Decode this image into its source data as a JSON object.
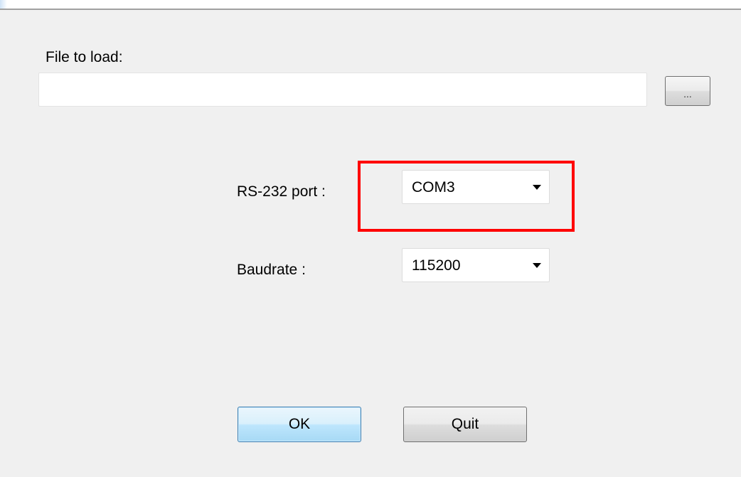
{
  "form": {
    "file_label": "File to load:",
    "file_value": "",
    "browse_label": "...",
    "port_label": "RS-232 port :",
    "port_value": "COM3",
    "baud_label": "Baudrate :",
    "baud_value": "115200",
    "ok_label": "OK",
    "quit_label": "Quit"
  },
  "icons": {
    "dropdown": "chevron-down-icon"
  },
  "colors": {
    "highlight": "#ff0000",
    "default_button_border": "#3c7fb1",
    "background": "#f0f0f0"
  }
}
